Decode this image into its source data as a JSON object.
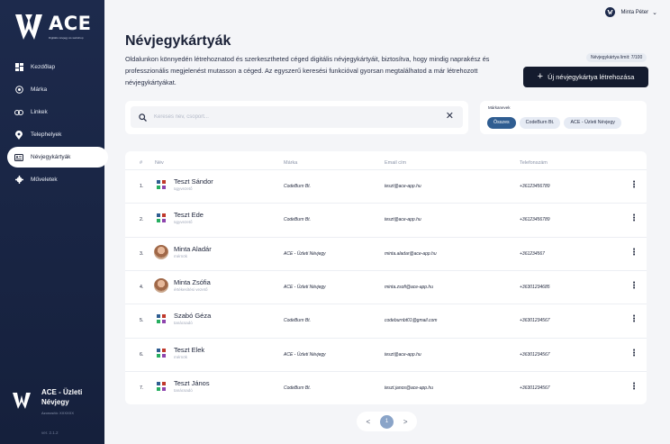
{
  "sidebar": {
    "logo_text": "ACE",
    "logo_tagline": "Digitális névjegy és webshop",
    "items": [
      {
        "label": "Kezdőlap",
        "icon": "dashboard-icon"
      },
      {
        "label": "Márka",
        "icon": "brand-icon"
      },
      {
        "label": "Linkek",
        "icon": "link-icon"
      },
      {
        "label": "Telephelyek",
        "icon": "location-pin-icon"
      },
      {
        "label": "Névjegykártyák",
        "icon": "contact-card-icon",
        "active": true
      },
      {
        "label": "Műveletek",
        "icon": "gear-icon"
      }
    ],
    "company": {
      "name": "ACE - Üzleti Névjegy",
      "sub": "Azonosító: XXXXXX",
      "version": "ver. 2.1.2"
    }
  },
  "user": {
    "name": "Minta Péter"
  },
  "header": {
    "title": "Névjegykártyák",
    "description": "Oldalunkon könnyedén létrehoznatod és szerkesztheted céged digitális névjegykártyáit, biztosítva, hogy mindig naprakész és professzionális megjelenést mutasson a céged. Az egyszerű keresési funkcióval gyorsan megtalálhatod a már létrehozott névjegykártyákat.",
    "limit_badge": "Névjegykártya limit: 7/100",
    "create_button": "Új névjegykártya létrehozása"
  },
  "search": {
    "placeholder": "Keresés név, csoport..."
  },
  "filter": {
    "label": "Márkanevek",
    "chips": [
      "Összes",
      "CodeBurn Bt.",
      "ACE - Üzleti Névjegy"
    ]
  },
  "table": {
    "headers": [
      "#",
      "Név",
      "Márka",
      "Email cím",
      "Telefonszám"
    ],
    "rows": [
      {
        "num": "1.",
        "name": "Teszt Sándor",
        "role": "ügyvezető",
        "brand": "CodeBurn Bt.",
        "email": "teszt@ace-app.hu",
        "phone": "+36123456789",
        "avatar": "logo"
      },
      {
        "num": "2.",
        "name": "Teszt Ede",
        "role": "ügyvezető",
        "brand": "CodeBurn Bt.",
        "email": "teszt@ace-app.hu",
        "phone": "+36123456789",
        "avatar": "logo"
      },
      {
        "num": "3.",
        "name": "Minta Aladár",
        "role": "mérnök",
        "brand": "ACE - Üzleti Névjegy",
        "email": "minta.aladar@ace-app.hu",
        "phone": "+361234567",
        "avatar": "photo"
      },
      {
        "num": "4.",
        "name": "Minta Zsófia",
        "role": "értékesítési vezető",
        "brand": "ACE - Üzleti Névjegy",
        "email": "minta.zsofi@ace-app.hu",
        "phone": "+36301234685",
        "avatar": "photo"
      },
      {
        "num": "5.",
        "name": "Szabó Géza",
        "role": "tanácsadó",
        "brand": "CodeBurn Bt.",
        "email": "codeburnbt01@gmail.com",
        "phone": "+36301234567",
        "avatar": "logo"
      },
      {
        "num": "6.",
        "name": "Teszt Elek",
        "role": "mérnök",
        "brand": "ACE - Üzleti Névjegy",
        "email": "teszt@ace-app.hu",
        "phone": "+36301234567",
        "avatar": "logo"
      },
      {
        "num": "7.",
        "name": "Teszt János",
        "role": "tanácsadó",
        "brand": "CodeBurn Bt.",
        "email": "teszt.janos@ace-app.hu",
        "phone": "+36301234567",
        "avatar": "logo"
      }
    ]
  },
  "pagination": {
    "prev": "<",
    "current": "1",
    "next": ">"
  },
  "colors": {
    "sidebar": "#1d2a4c",
    "accent": "#2f5d91",
    "button": "#141b2e"
  }
}
